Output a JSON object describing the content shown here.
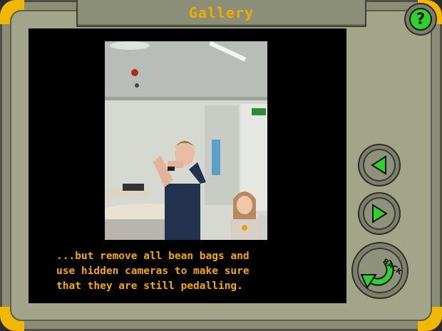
{
  "window": {
    "title": "Gallery"
  },
  "help_button": {
    "icon": "question-mark-icon",
    "label": "?"
  },
  "caption": {
    "text": "...but remove all bean bags and\nuse hidden cameras to make sure\nthat they are still pedalling."
  },
  "nav": {
    "prev_icon": "triangle-left-icon",
    "next_icon": "triangle-right-icon",
    "back_icon": "back-arrow-icon",
    "back_label": "BACK"
  },
  "colors": {
    "accent": "#f2a900",
    "frame": "#8a8d74",
    "corner": "#f2b705",
    "button_green": "#2fd12f"
  }
}
